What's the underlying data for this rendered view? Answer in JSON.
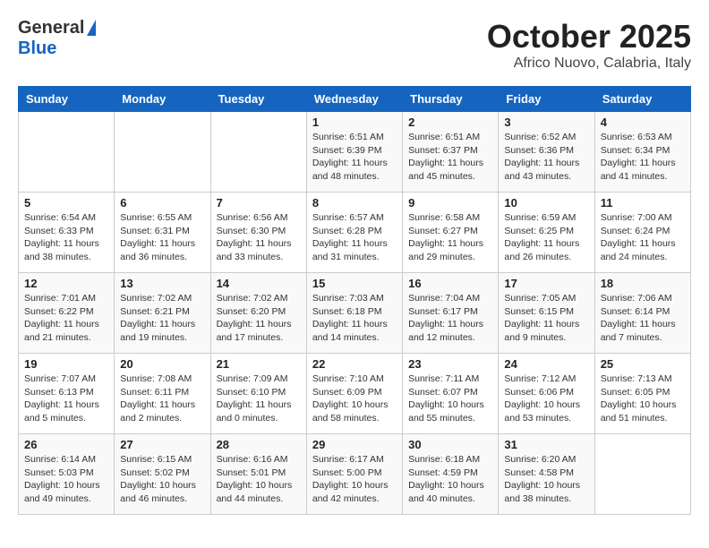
{
  "header": {
    "logo_general": "General",
    "logo_blue": "Blue",
    "month_title": "October 2025",
    "subtitle": "Africo Nuovo, Calabria, Italy"
  },
  "days_of_week": [
    "Sunday",
    "Monday",
    "Tuesday",
    "Wednesday",
    "Thursday",
    "Friday",
    "Saturday"
  ],
  "weeks": [
    [
      {
        "day": "",
        "info": ""
      },
      {
        "day": "",
        "info": ""
      },
      {
        "day": "",
        "info": ""
      },
      {
        "day": "1",
        "info": "Sunrise: 6:51 AM\nSunset: 6:39 PM\nDaylight: 11 hours\nand 48 minutes."
      },
      {
        "day": "2",
        "info": "Sunrise: 6:51 AM\nSunset: 6:37 PM\nDaylight: 11 hours\nand 45 minutes."
      },
      {
        "day": "3",
        "info": "Sunrise: 6:52 AM\nSunset: 6:36 PM\nDaylight: 11 hours\nand 43 minutes."
      },
      {
        "day": "4",
        "info": "Sunrise: 6:53 AM\nSunset: 6:34 PM\nDaylight: 11 hours\nand 41 minutes."
      }
    ],
    [
      {
        "day": "5",
        "info": "Sunrise: 6:54 AM\nSunset: 6:33 PM\nDaylight: 11 hours\nand 38 minutes."
      },
      {
        "day": "6",
        "info": "Sunrise: 6:55 AM\nSunset: 6:31 PM\nDaylight: 11 hours\nand 36 minutes."
      },
      {
        "day": "7",
        "info": "Sunrise: 6:56 AM\nSunset: 6:30 PM\nDaylight: 11 hours\nand 33 minutes."
      },
      {
        "day": "8",
        "info": "Sunrise: 6:57 AM\nSunset: 6:28 PM\nDaylight: 11 hours\nand 31 minutes."
      },
      {
        "day": "9",
        "info": "Sunrise: 6:58 AM\nSunset: 6:27 PM\nDaylight: 11 hours\nand 29 minutes."
      },
      {
        "day": "10",
        "info": "Sunrise: 6:59 AM\nSunset: 6:25 PM\nDaylight: 11 hours\nand 26 minutes."
      },
      {
        "day": "11",
        "info": "Sunrise: 7:00 AM\nSunset: 6:24 PM\nDaylight: 11 hours\nand 24 minutes."
      }
    ],
    [
      {
        "day": "12",
        "info": "Sunrise: 7:01 AM\nSunset: 6:22 PM\nDaylight: 11 hours\nand 21 minutes."
      },
      {
        "day": "13",
        "info": "Sunrise: 7:02 AM\nSunset: 6:21 PM\nDaylight: 11 hours\nand 19 minutes."
      },
      {
        "day": "14",
        "info": "Sunrise: 7:02 AM\nSunset: 6:20 PM\nDaylight: 11 hours\nand 17 minutes."
      },
      {
        "day": "15",
        "info": "Sunrise: 7:03 AM\nSunset: 6:18 PM\nDaylight: 11 hours\nand 14 minutes."
      },
      {
        "day": "16",
        "info": "Sunrise: 7:04 AM\nSunset: 6:17 PM\nDaylight: 11 hours\nand 12 minutes."
      },
      {
        "day": "17",
        "info": "Sunrise: 7:05 AM\nSunset: 6:15 PM\nDaylight: 11 hours\nand 9 minutes."
      },
      {
        "day": "18",
        "info": "Sunrise: 7:06 AM\nSunset: 6:14 PM\nDaylight: 11 hours\nand 7 minutes."
      }
    ],
    [
      {
        "day": "19",
        "info": "Sunrise: 7:07 AM\nSunset: 6:13 PM\nDaylight: 11 hours\nand 5 minutes."
      },
      {
        "day": "20",
        "info": "Sunrise: 7:08 AM\nSunset: 6:11 PM\nDaylight: 11 hours\nand 2 minutes."
      },
      {
        "day": "21",
        "info": "Sunrise: 7:09 AM\nSunset: 6:10 PM\nDaylight: 11 hours\nand 0 minutes."
      },
      {
        "day": "22",
        "info": "Sunrise: 7:10 AM\nSunset: 6:09 PM\nDaylight: 10 hours\nand 58 minutes."
      },
      {
        "day": "23",
        "info": "Sunrise: 7:11 AM\nSunset: 6:07 PM\nDaylight: 10 hours\nand 55 minutes."
      },
      {
        "day": "24",
        "info": "Sunrise: 7:12 AM\nSunset: 6:06 PM\nDaylight: 10 hours\nand 53 minutes."
      },
      {
        "day": "25",
        "info": "Sunrise: 7:13 AM\nSunset: 6:05 PM\nDaylight: 10 hours\nand 51 minutes."
      }
    ],
    [
      {
        "day": "26",
        "info": "Sunrise: 6:14 AM\nSunset: 5:03 PM\nDaylight: 10 hours\nand 49 minutes."
      },
      {
        "day": "27",
        "info": "Sunrise: 6:15 AM\nSunset: 5:02 PM\nDaylight: 10 hours\nand 46 minutes."
      },
      {
        "day": "28",
        "info": "Sunrise: 6:16 AM\nSunset: 5:01 PM\nDaylight: 10 hours\nand 44 minutes."
      },
      {
        "day": "29",
        "info": "Sunrise: 6:17 AM\nSunset: 5:00 PM\nDaylight: 10 hours\nand 42 minutes."
      },
      {
        "day": "30",
        "info": "Sunrise: 6:18 AM\nSunset: 4:59 PM\nDaylight: 10 hours\nand 40 minutes."
      },
      {
        "day": "31",
        "info": "Sunrise: 6:20 AM\nSunset: 4:58 PM\nDaylight: 10 hours\nand 38 minutes."
      },
      {
        "day": "",
        "info": ""
      }
    ]
  ]
}
